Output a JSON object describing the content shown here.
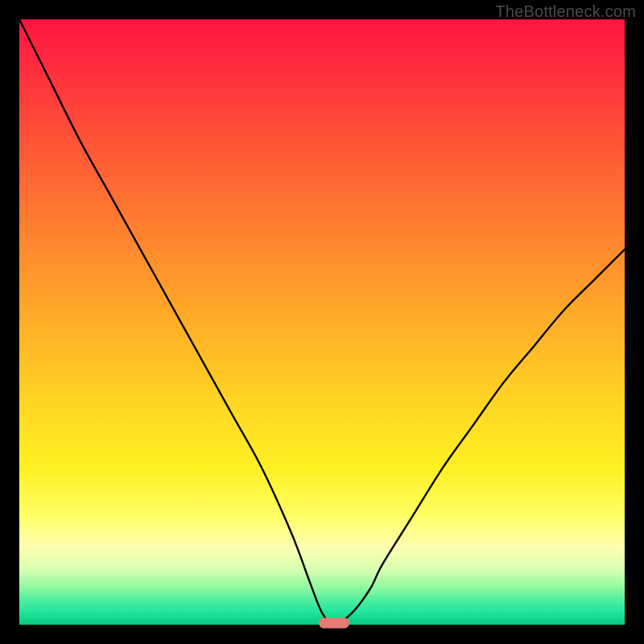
{
  "watermark": "TheBottleneck.com",
  "colors": {
    "frame": "#000000",
    "gradient_top": "#ff1440",
    "gradient_mid": "#ffd724",
    "gradient_bottom": "#08c97d",
    "curve": "#000000",
    "marker": "#e77a74"
  },
  "chart_data": {
    "type": "line",
    "title": "",
    "xlabel": "",
    "ylabel": "",
    "xlim": [
      0,
      100
    ],
    "ylim": [
      0,
      100
    ],
    "grid": false,
    "x": [
      0,
      5,
      10,
      15,
      20,
      25,
      30,
      35,
      40,
      45,
      48,
      50,
      52,
      55,
      58,
      60,
      65,
      70,
      75,
      80,
      85,
      90,
      95,
      100
    ],
    "values": [
      100,
      90,
      80,
      71,
      62,
      53,
      44,
      35,
      26,
      15,
      7,
      2,
      0,
      2,
      6,
      10,
      18,
      26,
      33,
      40,
      46,
      52,
      57,
      62
    ],
    "note": "V-shaped bottleneck curve; minimum (optimal balance) near x≈52%. Left branch steeper than right.",
    "marker": {
      "x": 52,
      "y": 0,
      "width_pct": 5
    }
  }
}
